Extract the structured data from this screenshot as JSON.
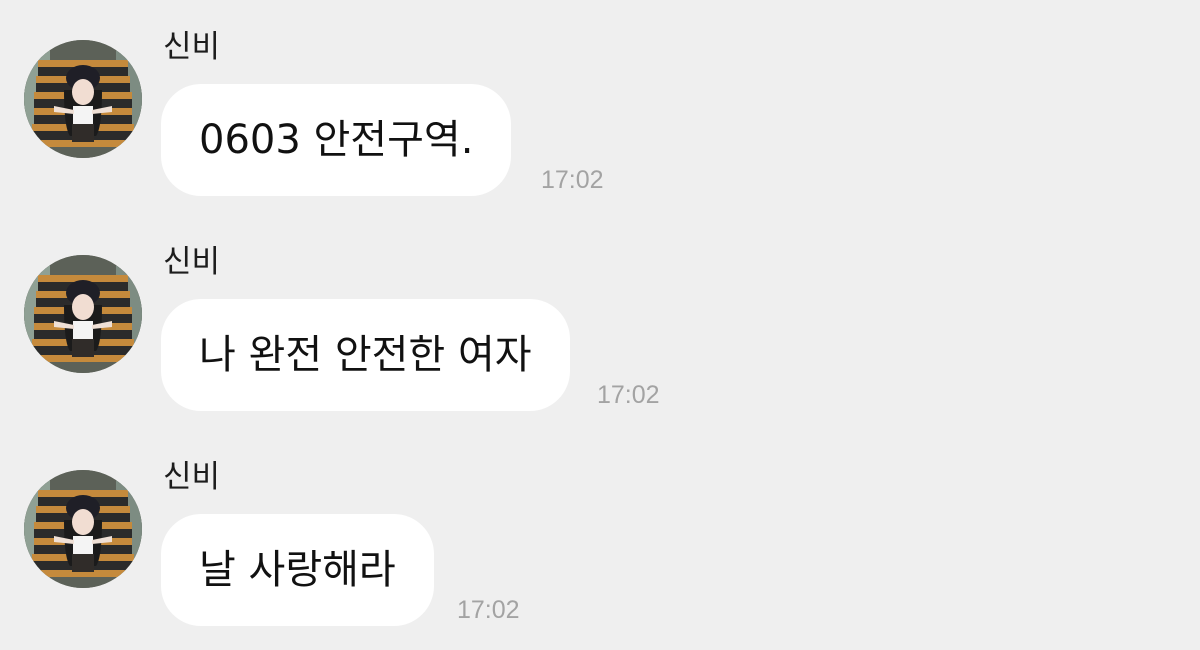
{
  "chat": {
    "messages": [
      {
        "sender": "신비",
        "text": "0603 안전구역.",
        "time": "17:02",
        "avatar_icon": "profile-photo"
      },
      {
        "sender": "신비",
        "text": "나 완전 안전한 여자",
        "time": "17:02",
        "avatar_icon": "profile-photo"
      },
      {
        "sender": "신비",
        "text": "날 사랑해라",
        "time": "17:02",
        "avatar_icon": "profile-photo"
      }
    ]
  },
  "colors": {
    "background": "#efefef",
    "bubble": "#ffffff",
    "timestamp": "#a3a3a3"
  }
}
